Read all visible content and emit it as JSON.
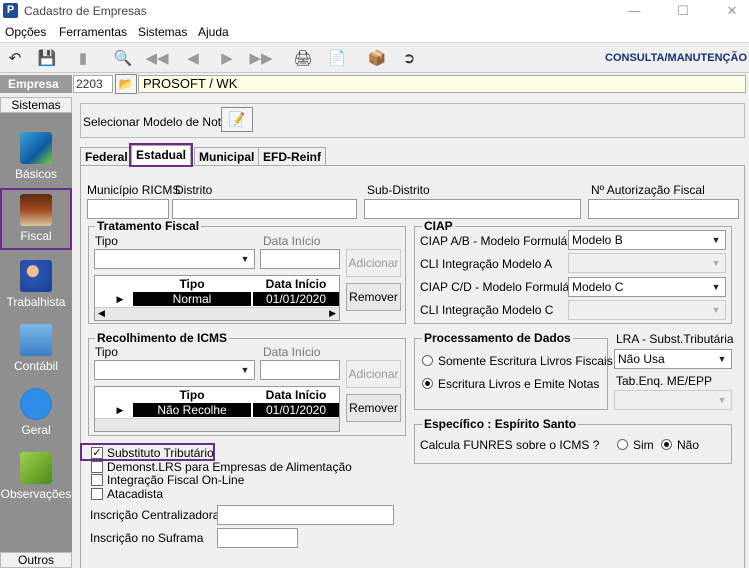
{
  "window": {
    "title": "Cadastro de Empresas",
    "icon_letter": "P"
  },
  "menubar": [
    "Opções",
    "Ferramentas",
    "Sistemas",
    "Ajuda"
  ],
  "toolbar": {
    "mode_label": "CONSULTA/MANUTENÇÃO"
  },
  "empresa": {
    "label": "Empresa",
    "code": "2203",
    "name": "PROSOFT / WK"
  },
  "sidebar": {
    "header": "Sistemas",
    "items": [
      {
        "label": "Básicos",
        "icon": "book-icon"
      },
      {
        "label": "Fiscal",
        "icon": "ledger-icon"
      },
      {
        "label": "Trabalhista",
        "icon": "worker-icon"
      },
      {
        "label": "Contábil",
        "icon": "calculator-icon"
      },
      {
        "label": "Geral",
        "icon": "info-icon"
      },
      {
        "label": "Observações",
        "icon": "note-icon"
      }
    ],
    "footer": "Outros"
  },
  "modelo_nota": {
    "label": "Selecionar Modelo de Nota"
  },
  "tabs": [
    "Federal",
    "Estadual",
    "Municipal",
    "EFD-Reinf"
  ],
  "estadual": {
    "fields": {
      "municipio_ricms": "Município RICMS",
      "distrito": "Distrito",
      "sub_distrito": "Sub-Distrito",
      "autorizacao": "Nº Autorização Fiscal"
    },
    "tratamento": {
      "title": "Tratamento Fiscal",
      "tipo_label": "Tipo",
      "data_label": "Data Início",
      "add": "Adicionar",
      "remove": "Remover",
      "cols": [
        "Tipo",
        "Data Início"
      ],
      "rows": [
        {
          "tipo": "Normal",
          "data": "01/01/2020"
        }
      ]
    },
    "recolhimento": {
      "title": "Recolhimento de ICMS",
      "tipo_label": "Tipo",
      "data_label": "Data Início",
      "add": "Adicionar",
      "remove": "Remover",
      "cols": [
        "Tipo",
        "Data Início"
      ],
      "rows": [
        {
          "tipo": "Não Recolhe",
          "data": "01/01/2020"
        }
      ]
    },
    "ciap": {
      "title": "CIAP",
      "ab_label": "CIAP  A/B - Modelo Formulário",
      "ab_value": "Modelo B",
      "cli_a_label": "CLI Integração Modelo A",
      "cd_label": "CIAP C/D - Modelo Formulário",
      "cd_value": "Modelo C",
      "cli_c_label": "CLI Integração Modelo C"
    },
    "processamento": {
      "title": "Processamento de Dados",
      "opt1": "Somente Escritura Livros Fiscais",
      "opt2": "Escritura Livros e Emite Notas"
    },
    "lra": {
      "label": "LRA - Subst.Tributária",
      "value": "Não Usa",
      "tab_label": "Tab.Enq. ME/EPP"
    },
    "especifico": {
      "title": "Específico : Espírito Santo",
      "question": "Calcula FUNRES sobre o ICMS ?",
      "sim": "Sim",
      "nao": "Não"
    },
    "checks": [
      {
        "label": "Substituto Tributário",
        "checked": true
      },
      {
        "label": "Demonst.LRS para Empresas de Alimentação",
        "checked": false
      },
      {
        "label": "Integração Fiscal On-Line",
        "checked": false
      },
      {
        "label": "Atacadista",
        "checked": false
      }
    ],
    "inscricao_central": "Inscrição Centralizadora",
    "inscricao_suframa": "Inscrição no Suframa"
  }
}
